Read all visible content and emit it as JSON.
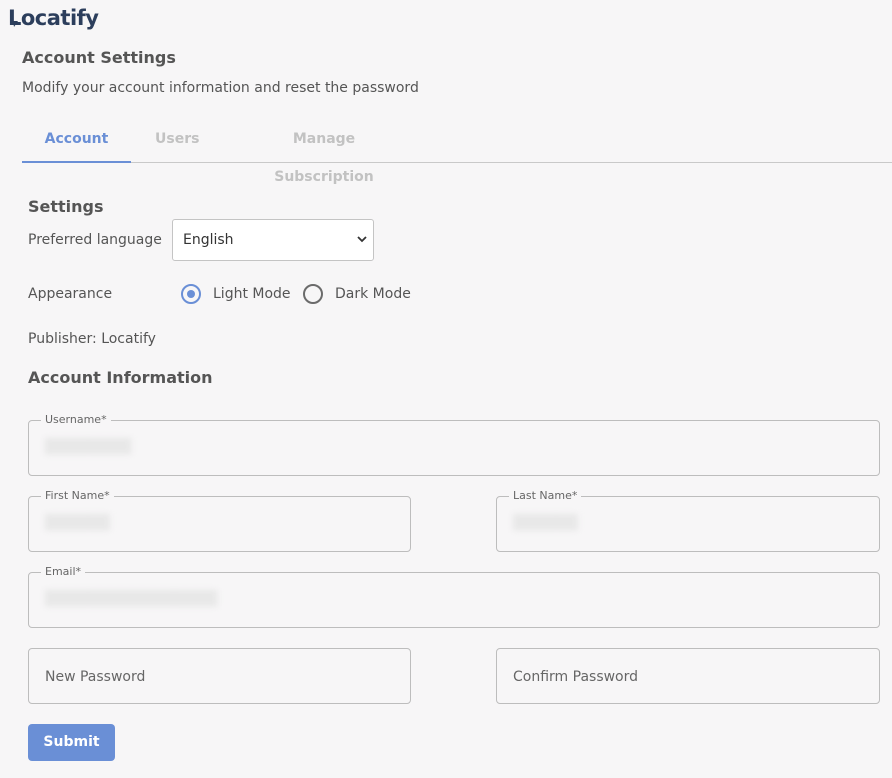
{
  "app": {
    "logo_text": "Locatify"
  },
  "header": {
    "title": "Account Settings",
    "subtitle": "Modify your account information and reset the password"
  },
  "tabs": [
    {
      "label": "Account",
      "active": true
    },
    {
      "label": "Users",
      "active": false
    },
    {
      "label": "Manage Subscription",
      "active": false
    }
  ],
  "settings": {
    "title": "Settings",
    "language_label": "Preferred language",
    "language_value": "English",
    "appearance_label": "Appearance",
    "appearance_options": [
      {
        "label": "Light Mode",
        "checked": true
      },
      {
        "label": "Dark Mode",
        "checked": false
      }
    ],
    "publisher_text": "Publisher: Locatify"
  },
  "account_info": {
    "title": "Account Information",
    "username_label": "Username*",
    "username_value": "████████",
    "first_name_label": "First Name*",
    "first_name_value": "██████",
    "last_name_label": "Last Name*",
    "last_name_value": "██████",
    "email_label": "Email*",
    "email_value": "████████████████",
    "new_password_placeholder": "New Password",
    "confirm_password_placeholder": "Confirm Password"
  },
  "actions": {
    "submit_label": "Submit"
  },
  "colors": {
    "accent": "#6a8fd6",
    "background": "#f7f6f7",
    "logo": "#2c3e5c"
  }
}
